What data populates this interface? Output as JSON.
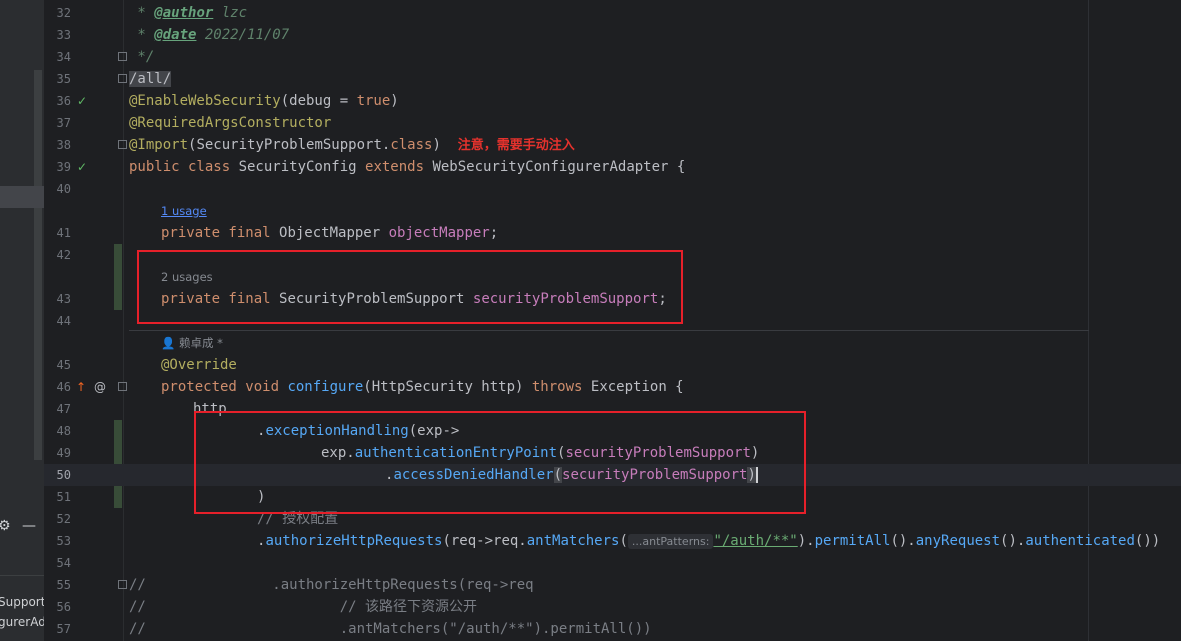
{
  "left_panel": {
    "gear": "⚙",
    "minimize": "—",
    "text1": "Support",
    "text2": "gurerAd"
  },
  "line_numbers": [
    "32",
    "33",
    "34",
    "35",
    "36",
    "37",
    "38",
    "39",
    "40",
    "41",
    "42",
    "43",
    "44",
    "45",
    "46",
    "47",
    "48",
    "49",
    "50",
    "51",
    "52",
    "53",
    "54",
    "55",
    "56",
    "57"
  ],
  "code": {
    "l32_star": " * ",
    "l32_tag": "@author",
    "l32_val": " lzc",
    "l33_star": " * ",
    "l33_tag": "@date",
    "l33_val": " 2022/11/07",
    "l34": " */",
    "l35": "/all/",
    "l36_ann": "@EnableWebSecurity",
    "l36_a": "(debug = ",
    "l36_kw": "true",
    "l36_b": ")",
    "l37_ann": "@RequiredArgsConstructor",
    "l38_ann": "@Import",
    "l38_a": "(SecurityProblemSupport.",
    "l38_kw": "class",
    "l38_b": ")",
    "l38_note": "注意，需要手动注入",
    "l39_kw1": "public class ",
    "l39_a": "SecurityConfig ",
    "l39_kw2": "extends ",
    "l39_b": "WebSecurityConfigurerAdapter {",
    "hint_1usage": "1 usage",
    "l41_kw": "private final ",
    "l41_a": "ObjectMapper ",
    "l41_fld": "objectMapper",
    "l41_b": ";",
    "hint_2usages": "2 usages",
    "l43_kw": "private final ",
    "l43_a": "SecurityProblemSupport ",
    "l43_fld": "securityProblemSupport",
    "l43_b": ";",
    "hint_author": "赖卓成 *",
    "l45_ann": "@Override",
    "l46_kw1": "protected void ",
    "l46_mt": "configure",
    "l46_a": "(HttpSecurity http) ",
    "l46_kw2": "throws ",
    "l46_b": "Exception {",
    "l47": "http",
    "l48_a": ".",
    "l48_mt": "exceptionHandling",
    "l48_b": "(exp->",
    "l49_a": "exp.",
    "l49_mt": "authenticationEntryPoint",
    "l49_b": "(",
    "l49_fld": "securityProblemSupport",
    "l49_c": ")",
    "l50_a": ".",
    "l50_mt": "accessDeniedHandler",
    "l50_b": "(",
    "l50_fld": "securityProblemSupport",
    "l50_c": ")",
    "l51": ")",
    "l52": "// 授权配置",
    "l53_a": ".",
    "l53_mt1": "authorizeHttpRequests",
    "l53_b": "(req->req.",
    "l53_mt2": "antMatchers",
    "l53_c": "(",
    "l53_inlay": "...antPatterns:",
    "l53_str": "\"/auth/**\"",
    "l53_d": ").",
    "l53_mt3": "permitAll",
    "l53_e": "().",
    "l53_mt4": "anyRequest",
    "l53_f": "().",
    "l53_mt5": "authenticated",
    "l53_g": "())",
    "l55": "//               .authorizeHttpRequests(req->req",
    "l56": "//                       // 该路径下资源公开",
    "l57": "//                       .antMatchers(\"/auth/**\").permitAll())"
  },
  "gutter_icons": {
    "spring_bean": "✓",
    "override": "@",
    "run": "↑"
  }
}
